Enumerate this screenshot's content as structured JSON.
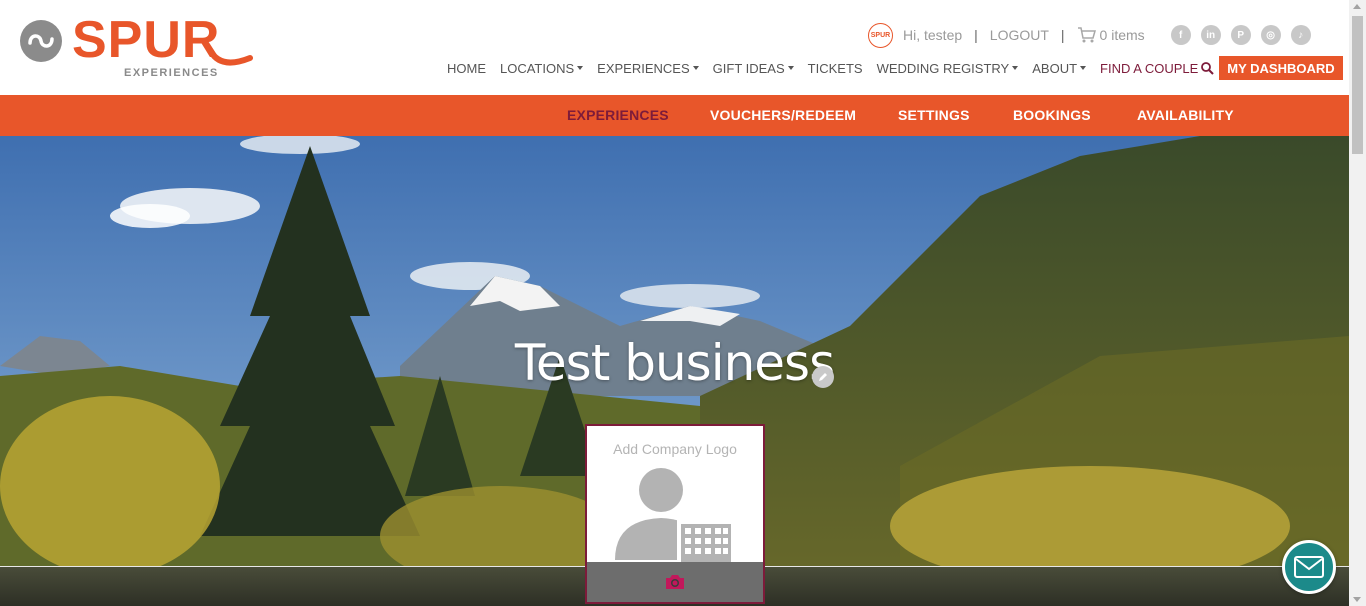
{
  "brand": {
    "name": "SPUR",
    "subtitle": "EXPERIENCES",
    "mini_logo_text": "SPUR",
    "color_primary": "#e8562a",
    "color_accent": "#7d1b3a"
  },
  "topbar": {
    "greeting": "Hi, testep",
    "sep1": "|",
    "logout": "LOGOUT",
    "sep2": "|",
    "cart": "0 items",
    "socials": [
      "facebook-icon",
      "linkedin-icon",
      "pinterest-icon",
      "instagram-icon",
      "tiktok-icon"
    ]
  },
  "nav": {
    "home": "HOME",
    "locations": "LOCATIONS",
    "experiences": "EXPERIENCES",
    "gift_ideas": "GIFT IDEAS",
    "tickets": "TICKETS",
    "wedding_registry": "WEDDING REGISTRY",
    "about": "ABOUT",
    "find_couple": "FIND A COUPLE",
    "dashboard": "MY DASHBOARD"
  },
  "subnav": {
    "experiences": "EXPERIENCES",
    "vouchers": "VOUCHERS/REDEEM",
    "settings": "SETTINGS",
    "bookings": "BOOKINGS",
    "availability": "AVAILABILITY"
  },
  "hero": {
    "title": "Test business",
    "logo_card_label": "Add Company Logo"
  }
}
